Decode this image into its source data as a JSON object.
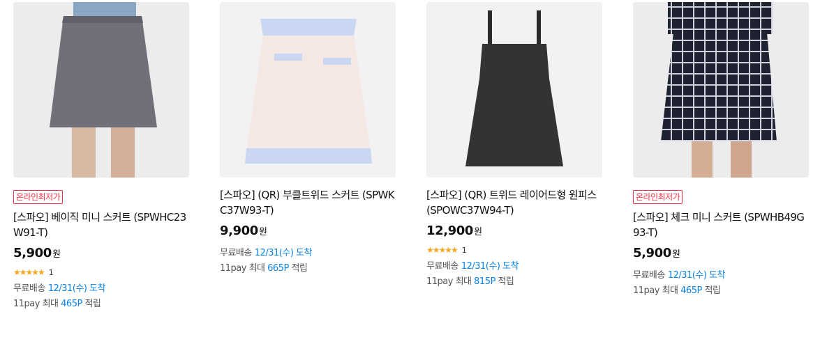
{
  "products": [
    {
      "badge": "온라인최저가",
      "title": "[스파오] 베이직 미니 스커트 (SPWHC23W91-T)",
      "price": "5,900",
      "currency": "원",
      "rating_stars": "★★★★★",
      "rating_count": "1",
      "delivery_label": "무료배송",
      "delivery_date": "12/31(수) 도착",
      "point_prefix": "11pay 최대",
      "point_value": "465P",
      "point_suffix": "적립"
    },
    {
      "title": "[스파오] (QR) 부클트위드 스커트 (SPWKC37W93-T)",
      "price": "9,900",
      "currency": "원",
      "delivery_label": "무료배송",
      "delivery_date": "12/31(수) 도착",
      "point_prefix": "11pay 최대",
      "point_value": "665P",
      "point_suffix": "적립"
    },
    {
      "title": "[스파오] (QR) 트위드 레이어드형 원피스 (SPOWC37W94-T)",
      "price": "12,900",
      "currency": "원",
      "rating_stars": "★★★★★",
      "rating_count": "1",
      "delivery_label": "무료배송",
      "delivery_date": "12/31(수) 도착",
      "point_prefix": "11pay 최대",
      "point_value": "815P",
      "point_suffix": "적립"
    },
    {
      "badge": "온라인최저가",
      "title": "[스파오] 체크 미니 스커트 (SPWHB49G93-T)",
      "price": "5,900",
      "currency": "원",
      "delivery_label": "무료배송",
      "delivery_date": "12/31(수) 도착",
      "point_prefix": "11pay 최대",
      "point_value": "465P",
      "point_suffix": "적립"
    }
  ],
  "colors": {
    "badge": "#f43142",
    "link_blue": "#0b83e6",
    "star": "#f5a623"
  }
}
